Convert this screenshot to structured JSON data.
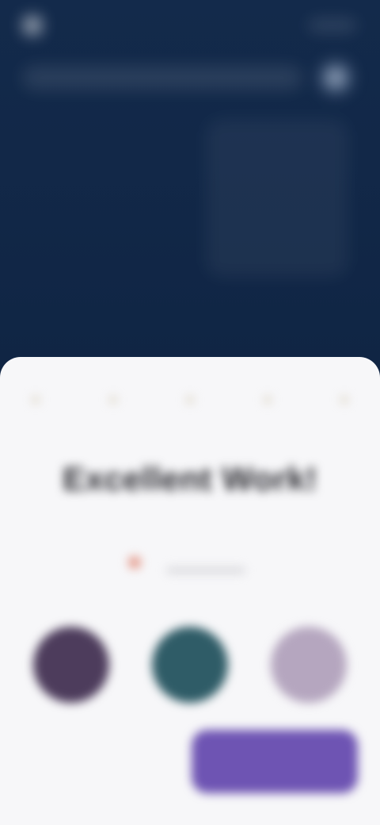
{
  "header": {
    "status_text": "",
    "search_placeholder": ""
  },
  "sheet": {
    "title": "Excellent Work!",
    "tag_text": "",
    "secondary_button_label": "",
    "primary_button_label": ""
  },
  "colors": {
    "background": "#102544",
    "sheet_background": "#f7f7f9",
    "title_text": "#2a2a30",
    "primary_button": "#6e54b3",
    "tag_dot": "#e59a8b",
    "swatch_1": "#4d3c5c",
    "swatch_2": "#2f5c67",
    "swatch_3": "#b5a6bf"
  },
  "icons": {
    "back": "back-icon",
    "sparkle": "sparkle-icon"
  }
}
